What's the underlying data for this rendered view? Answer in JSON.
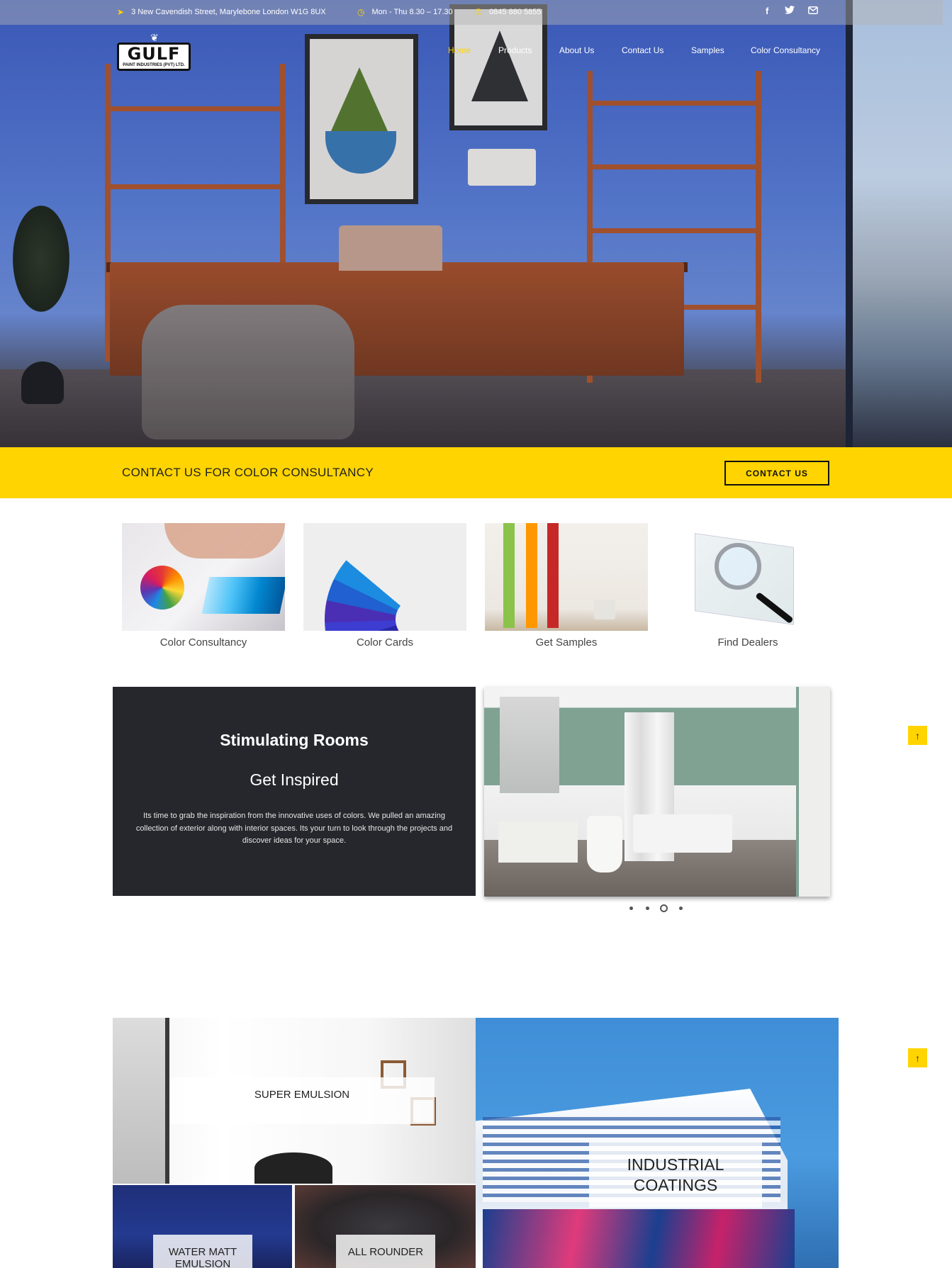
{
  "topbar": {
    "address": "3 New Cavendish Street, Marylebone London W1G 8UX",
    "hours": "Mon - Thu 8.30 – 17.30",
    "phone": "0845 880 5855",
    "social": [
      "facebook-icon",
      "twitter-icon",
      "mail-icon"
    ]
  },
  "logo": {
    "word": "GULF",
    "sub": "PAINT INDUSTRIES (PVT) LTD."
  },
  "nav": {
    "items": [
      {
        "label": "Home",
        "active": true
      },
      {
        "label": "Products"
      },
      {
        "label": "About Us"
      },
      {
        "label": "Contact Us"
      },
      {
        "label": "Samples"
      },
      {
        "label": "Color Consultancy"
      }
    ]
  },
  "cta": {
    "text": "CONTACT US FOR COLOR CONSULTANCY",
    "button": "CONTACT US"
  },
  "services": [
    {
      "label": "Color Consultancy"
    },
    {
      "label": "Color Cards"
    },
    {
      "label": "Get Samples"
    },
    {
      "label": "Find Dealers"
    }
  ],
  "inspire": {
    "title": "Stimulating Rooms",
    "subtitle": "Get Inspired",
    "text": "Its time to grab the inspiration from the innovative uses of colors. We pulled an amazing collection of exterior along with interior spaces. Its your turn to look through the projects and discover ideas for your space."
  },
  "slider": {
    "count": 4,
    "active_index": 2
  },
  "products": {
    "super": "SUPER EMULSION",
    "industrial": "INDUSTRIAL COATINGS",
    "water": "WATER MATT EMULSION",
    "all": "ALL ROUNDER"
  },
  "colors": {
    "accent": "#ffd400",
    "dark_panel": "#25272c"
  }
}
